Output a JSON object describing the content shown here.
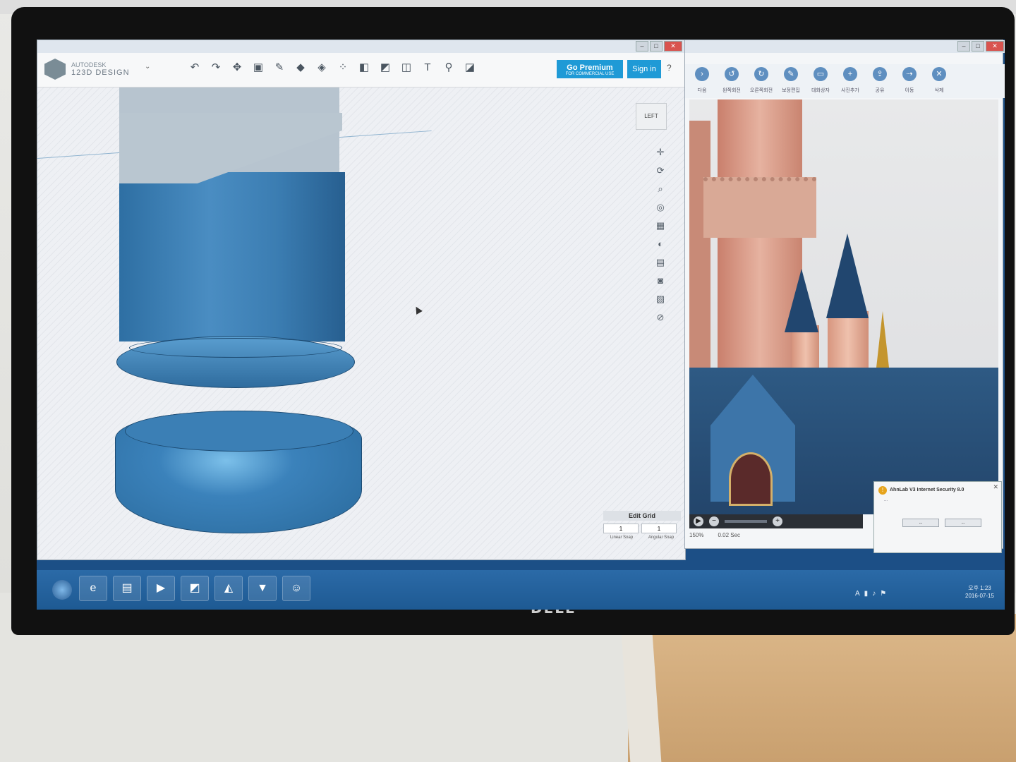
{
  "app_left": {
    "brand_line1": "AUTODESK",
    "brand_line2": "123D DESIGN",
    "premium_label": "Go Premium",
    "premium_sub": "FOR COMMERCIAL USE",
    "signin_label": "Sign in",
    "help_label": "?",
    "viewcube_label": "LEFT",
    "edit_grid": {
      "title": "Edit Grid",
      "linear_value": "1",
      "angular_value": "1",
      "linear_label": "Linear Snap",
      "angular_label": "Angular Snap"
    }
  },
  "app_right": {
    "toolbar": [
      {
        "label": "다음",
        "icon": "arrow-right-icon"
      },
      {
        "label": "왼쪽회전",
        "icon": "rotate-left-icon"
      },
      {
        "label": "오른쪽회전",
        "icon": "rotate-right-icon"
      },
      {
        "label": "보정편집",
        "icon": "edit-icon"
      },
      {
        "label": "대화상자",
        "icon": "dialog-icon"
      },
      {
        "label": "사진추가",
        "icon": "add-photo-icon"
      },
      {
        "label": "공유",
        "icon": "share-icon"
      },
      {
        "label": "이동",
        "icon": "move-icon"
      },
      {
        "label": "삭제",
        "icon": "delete-icon"
      }
    ],
    "status": {
      "zoom": "150%",
      "time": "0.02 Sec"
    }
  },
  "ahnlab": {
    "title": "AhnLab V3 Internet Security 8.0",
    "body": "...",
    "btn1": "...",
    "btn2": "..."
  },
  "taskbar": {
    "tray_lang": "A",
    "clock_time": "오후 1:23",
    "clock_date": "2016-07-15"
  },
  "monitor_brand": "DELL"
}
